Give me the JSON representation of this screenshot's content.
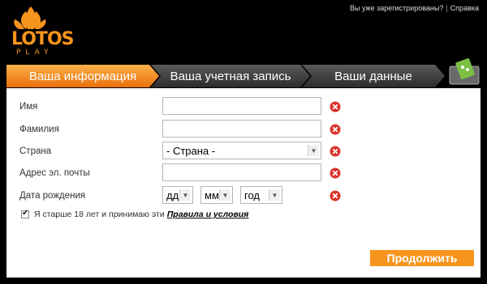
{
  "header": {
    "logo_text": "LOTOS",
    "logo_sub": "PLAY",
    "link_login": "Вы уже зарегистрированы?",
    "link_separator": "|",
    "link_help": "Справка"
  },
  "steps": [
    {
      "label": "Ваша информация",
      "active": true
    },
    {
      "label": "Ваша учетная запись",
      "active": false
    },
    {
      "label": "Ваши данные",
      "active": false
    }
  ],
  "form": {
    "first_name_label": "Имя",
    "last_name_label": "Фамилия",
    "country_label": "Страна",
    "country_value": "- Страна -",
    "email_label": "Адрес эл. почты",
    "birth_label": "Дата рождения",
    "day_value": "дд",
    "month_value": "мм",
    "year_value": "год",
    "agree_text": "Я старше 18 лет и принимаю эти",
    "terms_link": "Правила и условия",
    "agree_checked": true
  },
  "actions": {
    "continue_label": "Продолжить"
  },
  "colors": {
    "accent": "#f7941d",
    "step_inactive": "#444444",
    "error": "#d9342b"
  }
}
